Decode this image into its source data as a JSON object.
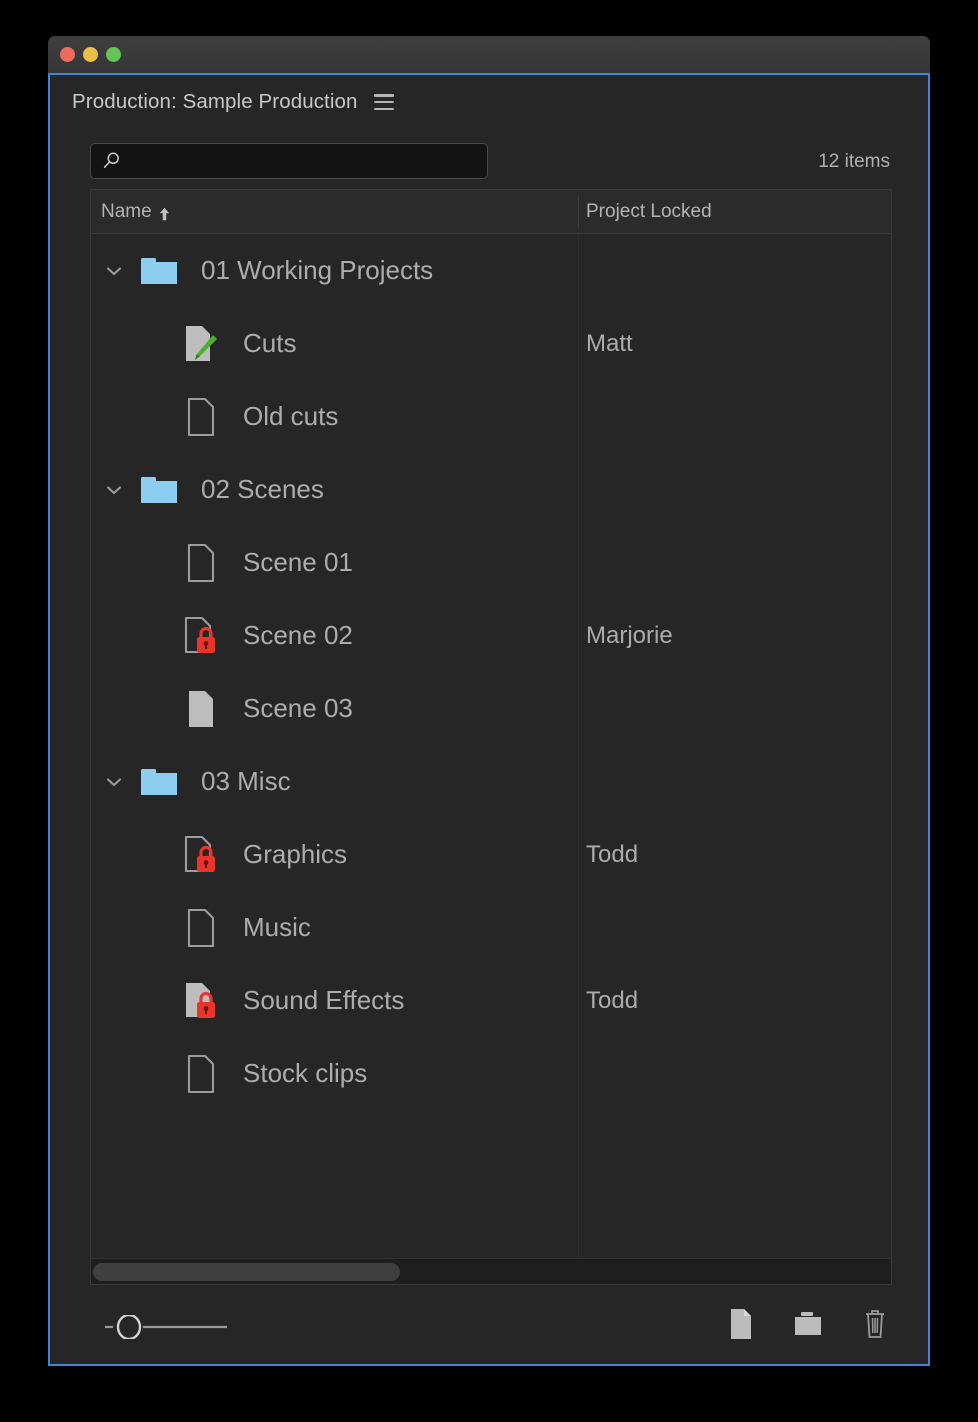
{
  "window": {
    "traffic_lights": [
      {
        "name": "close",
        "color": "#ed6a5e"
      },
      {
        "name": "minimize",
        "color": "#e8c14a"
      },
      {
        "name": "maximize",
        "color": "#62c554"
      }
    ],
    "focus_border_color": "#3d86d8"
  },
  "panel": {
    "title": "Production: Sample Production",
    "menu_icon": "hamburger-menu-icon"
  },
  "search": {
    "value": "",
    "placeholder": "",
    "icon": "search-icon"
  },
  "item_count": "12 items",
  "columns": {
    "name": "Name",
    "name_sort": "ascending",
    "locked": "Project Locked"
  },
  "rows": [
    {
      "label": "01 Working Projects",
      "depth": 0,
      "icon": "folder-icon",
      "twisty": "chevron-down-icon",
      "locked": ""
    },
    {
      "label": "Cuts",
      "depth": 1,
      "icon": "project-open-icon",
      "twisty": "",
      "locked": "Matt"
    },
    {
      "label": "Old cuts",
      "depth": 1,
      "icon": "project-icon",
      "twisty": "",
      "locked": ""
    },
    {
      "label": "02 Scenes",
      "depth": 0,
      "icon": "folder-icon",
      "twisty": "chevron-down-icon",
      "locked": ""
    },
    {
      "label": "Scene 01",
      "depth": 1,
      "icon": "project-icon",
      "twisty": "",
      "locked": ""
    },
    {
      "label": "Scene 02",
      "depth": 1,
      "icon": "project-locked-icon",
      "twisty": "",
      "locked": "Marjorie"
    },
    {
      "label": "Scene 03",
      "depth": 1,
      "icon": "project-filled-icon",
      "twisty": "",
      "locked": ""
    },
    {
      "label": "03 Misc",
      "depth": 0,
      "icon": "folder-icon",
      "twisty": "chevron-down-icon",
      "locked": ""
    },
    {
      "label": "Graphics",
      "depth": 1,
      "icon": "project-locked-icon",
      "twisty": "",
      "locked": "Todd"
    },
    {
      "label": "Music",
      "depth": 1,
      "icon": "project-icon",
      "twisty": "",
      "locked": ""
    },
    {
      "label": "Sound Effects",
      "depth": 1,
      "icon": "project-filled-locked-icon",
      "twisty": "",
      "locked": "Todd"
    },
    {
      "label": "Stock clips",
      "depth": 1,
      "icon": "project-icon",
      "twisty": "",
      "locked": ""
    }
  ],
  "scrollbar": {
    "orientation": "horizontal",
    "thumb_fraction": 0.38
  },
  "bottom_toolbar": {
    "zoom_slider_value": 0.13,
    "buttons": [
      {
        "name": "new-item-button",
        "icon": "document-icon"
      },
      {
        "name": "new-folder-button",
        "icon": "folder-icon"
      },
      {
        "name": "delete-button",
        "icon": "trash-icon"
      }
    ]
  },
  "colors": {
    "folder_blue": "#8ccdf0",
    "lock_red": "#e8352c",
    "pencil_green": "#4caf32",
    "panel_bg": "#262626",
    "text": "#adadad"
  }
}
